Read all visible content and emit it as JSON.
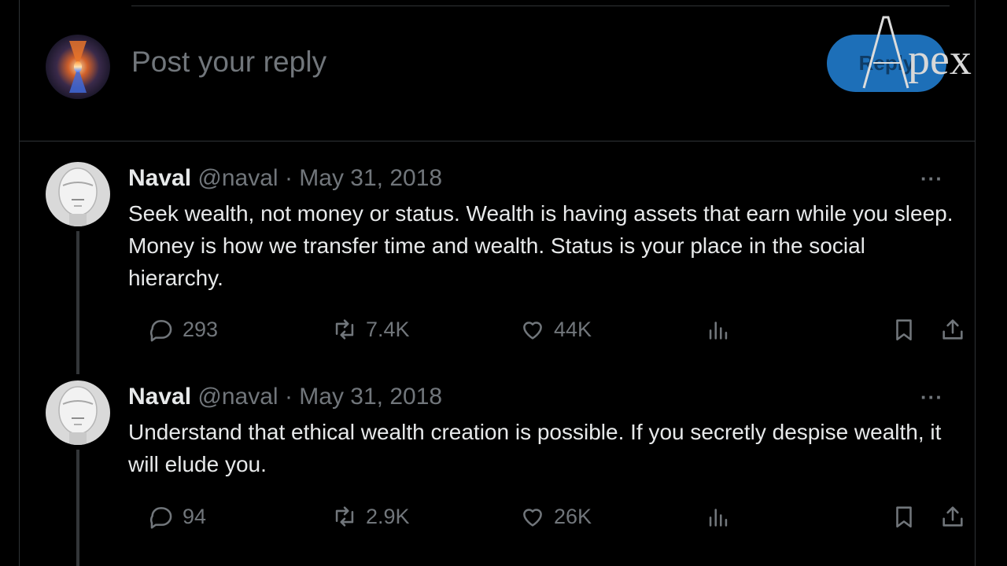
{
  "composer": {
    "placeholder": "Post your reply",
    "reply_label": "Reply"
  },
  "watermark": {
    "text": "Apex"
  },
  "posts": [
    {
      "name": "Naval",
      "handle": "@naval",
      "separator": "·",
      "date": "May 31, 2018",
      "more": "···",
      "text": "Seek wealth, not money or status. Wealth is having assets that earn while you sleep. Money is how we transfer time and wealth. Status is your place in the social hierarchy.",
      "replies": "293",
      "reposts": "7.4K",
      "likes": "44K"
    },
    {
      "name": "Naval",
      "handle": "@naval",
      "separator": "·",
      "date": "May 31, 2018",
      "more": "···",
      "text": "Understand that ethical wealth creation is possible. If you secretly despise wealth, it will elude you.",
      "replies": "94",
      "reposts": "2.9K",
      "likes": "26K"
    }
  ],
  "icons": {
    "reply": "reply-icon",
    "repost": "repost-icon",
    "like": "heart-icon",
    "views": "analytics-icon",
    "bookmark": "bookmark-icon",
    "share": "share-icon"
  },
  "colors": {
    "background": "#000000",
    "text": "#e7e9ea",
    "muted": "#71767b",
    "border": "#2f3336",
    "reply_button": "#1d6fb8"
  }
}
